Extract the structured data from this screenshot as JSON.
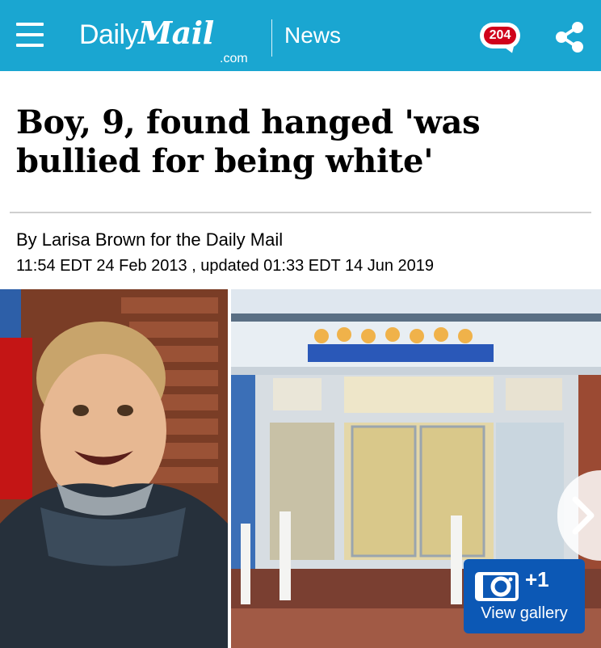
{
  "header": {
    "brand_daily": "Daily",
    "brand_mail": "Mail",
    "brand_domain": ".com",
    "section": "News",
    "comment_count": "204",
    "bg_color": "#1aa6d1",
    "icons": [
      "menu-icon",
      "comment-bubble-icon",
      "share-icon"
    ]
  },
  "article": {
    "headline": "Boy, 9, found hanged 'was bullied for being white'",
    "byline": "By Larisa Brown for the Daily Mail",
    "dateline": "11:54 EDT 24 Feb 2013 , updated 01:33 EDT 14 Jun 2019"
  },
  "gallery": {
    "extra_count": "+1",
    "label": "View gallery",
    "bg_color": "#0c58b5",
    "icons": [
      "camera-icon",
      "chevron-right-icon"
    ]
  }
}
